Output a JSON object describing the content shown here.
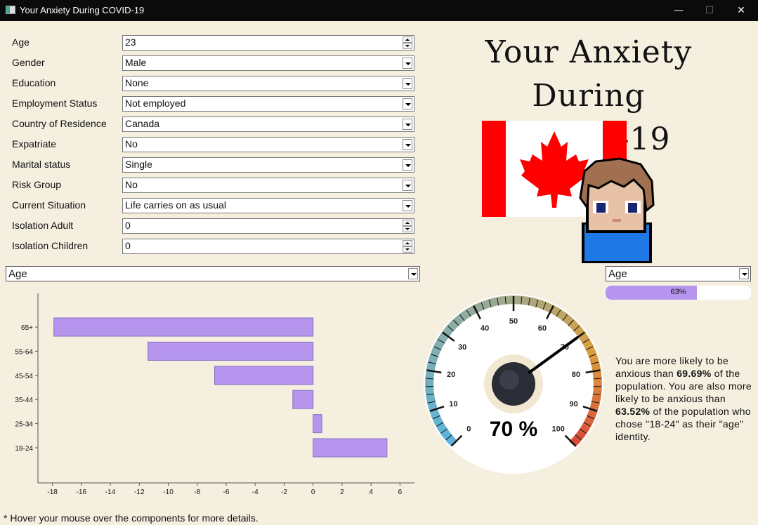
{
  "window": {
    "title": "Your Anxiety During COVID-19",
    "minimize": "—",
    "maximize": "☐",
    "close": "✕"
  },
  "form": {
    "fields": [
      {
        "label": "Age",
        "value": "23",
        "kind": "spin"
      },
      {
        "label": "Gender",
        "value": "Male",
        "kind": "dropdown"
      },
      {
        "label": "Education",
        "value": "None",
        "kind": "dropdown"
      },
      {
        "label": "Employment Status",
        "value": "Not employed",
        "kind": "dropdown"
      },
      {
        "label": "Country of Residence",
        "value": "Canada",
        "kind": "dropdown"
      },
      {
        "label": "Expatriate",
        "value": "No",
        "kind": "dropdown"
      },
      {
        "label": "Marital status",
        "value": "Single",
        "kind": "dropdown"
      },
      {
        "label": "Risk Group",
        "value": "No",
        "kind": "dropdown"
      },
      {
        "label": "Current Situation",
        "value": "Life carries on as usual",
        "kind": "dropdown"
      },
      {
        "label": "Isolation Adult",
        "value": "0",
        "kind": "spin"
      },
      {
        "label": "Isolation Children",
        "value": "0",
        "kind": "spin"
      }
    ]
  },
  "header": {
    "title_line1": "Your Anxiety During",
    "title_line2": "COVID-19"
  },
  "chart_selector": {
    "value": "Age"
  },
  "gauge_selector": {
    "value": "Age"
  },
  "percentile_bar": {
    "value": 0.63,
    "label": "63%"
  },
  "gauge": {
    "value": 70,
    "label": "70 %",
    "ticks": [
      "0",
      "10",
      "20",
      "30",
      "40",
      "50",
      "60",
      "70",
      "80",
      "90",
      "100"
    ],
    "colors": {
      "low": "#5bb4dc",
      "mid": "#a3a98a",
      "high": "#d94a3a"
    }
  },
  "description": {
    "p1": "You are more likely to be anxious than ",
    "v1": "69.69%",
    "p2": " of the population. You are also more likely to be anxious than ",
    "v2": "63.52%",
    "p3": " of the population who chose \"18-24\" as their \"age\" identity."
  },
  "footnote": "* Hover your mouse over the components for more details.",
  "chart_data": {
    "type": "bar",
    "orientation": "horizontal",
    "categories": [
      "65+",
      "55-64",
      "45-54",
      "35-44",
      "25-34",
      "18-24"
    ],
    "values": [
      -17.9,
      -11.4,
      -6.8,
      -1.4,
      0.6,
      5.1
    ],
    "xlim": [
      -19,
      7
    ],
    "xticks": [
      "-18",
      "-16",
      "-14",
      "-12",
      "-10",
      "-8",
      "-6",
      "-4",
      "-2",
      "0",
      "2",
      "4",
      "6"
    ],
    "grid": false,
    "colors": {
      "bar": "#b595ee",
      "edge": "#8a6fc0"
    }
  },
  "flag_colors": {
    "red": "#ff0000",
    "white": "#ffffff"
  }
}
